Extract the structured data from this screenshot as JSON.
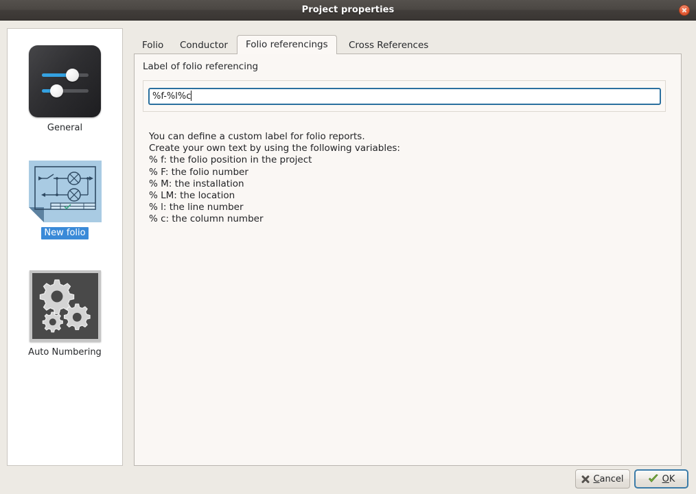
{
  "window": {
    "title": "Project properties",
    "close_icon": "close-icon"
  },
  "sidebar": {
    "items": [
      {
        "label": "General",
        "icon": "sliders-icon",
        "selected": false
      },
      {
        "label": "New folio",
        "icon": "schematic-page-icon",
        "selected": true
      },
      {
        "label": "Auto Numbering",
        "icon": "gears-icon",
        "selected": false
      }
    ]
  },
  "main": {
    "tabs": [
      {
        "label": "Folio",
        "active": false
      },
      {
        "label": "Conductor",
        "active": false
      },
      {
        "label": "Folio referencings",
        "active": true
      },
      {
        "label": "Cross References",
        "active": false
      }
    ],
    "field_label": "Label of folio referencing",
    "input": {
      "value": "%f-%l%c",
      "placeholder": ""
    },
    "help_lines": [
      "You can define a custom label for folio reports.",
      "Create your own text by using the following variables:",
      "% f: the folio position in the project",
      "% F: the folio number",
      "% M: the installation",
      "% LM: the location",
      "% l: the line number",
      "% c: the column number"
    ]
  },
  "buttons": {
    "cancel": {
      "label": "Cancel",
      "mnemonic": "C",
      "icon": "x-icon"
    },
    "ok": {
      "label": "OK",
      "mnemonic": "O",
      "icon": "check-icon",
      "focused": true
    }
  },
  "colors": {
    "titlebar": "#4b4743",
    "close_button": "#e8603a",
    "dialog_background": "#edeae4",
    "panel_background": "#faf7f4",
    "selection_blue": "#3a8ad8",
    "input_border": "#2a6f9e",
    "check_green": "#7cb342"
  }
}
